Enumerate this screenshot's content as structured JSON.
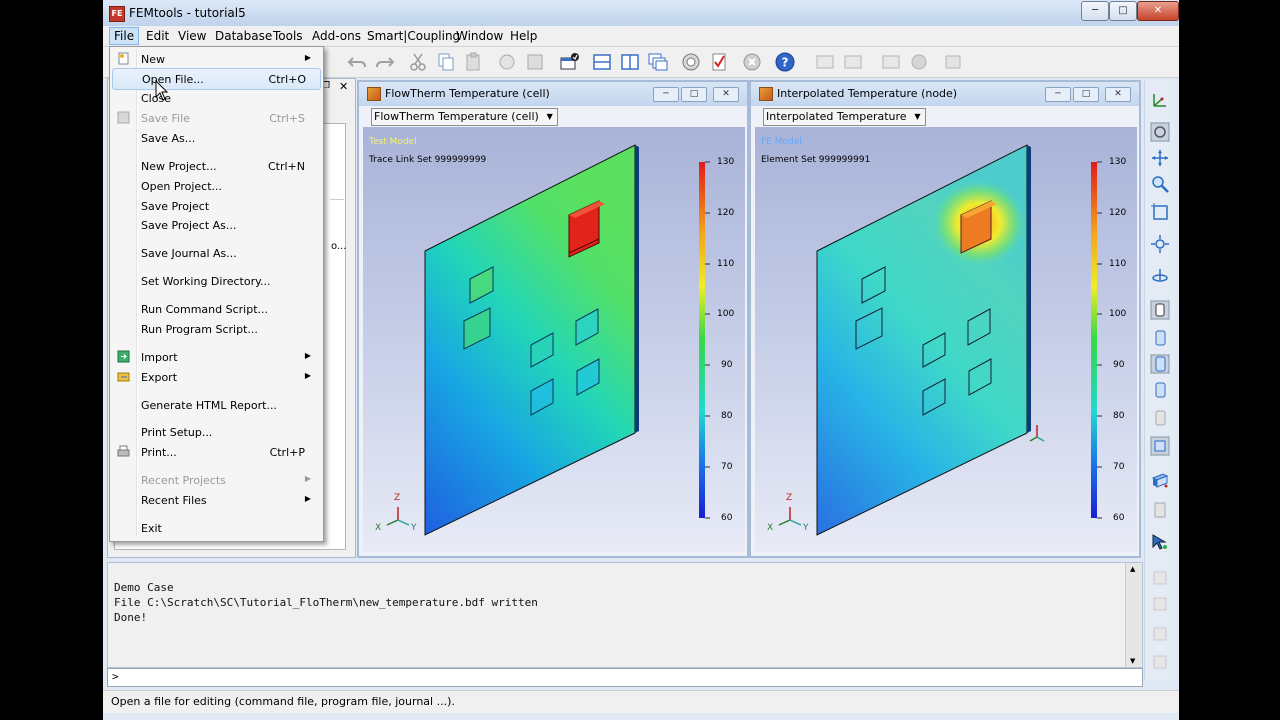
{
  "window": {
    "title": "FEMtools - tutorial5",
    "app_icon": "FE"
  },
  "menubar": [
    "File",
    "Edit",
    "View",
    "Database",
    "Tools",
    "Add-ons",
    "Smart|Coupling",
    "Window",
    "Help"
  ],
  "file_menu": [
    {
      "label": "New",
      "submenu": true
    },
    {
      "label": "Open File...",
      "shortcut": "Ctrl+O"
    },
    {
      "label": "Close"
    },
    {
      "label": "Save File",
      "shortcut": "Ctrl+S",
      "disabled": true
    },
    {
      "label": "Save As..."
    },
    {
      "label": "New Project...",
      "shortcut": "Ctrl+N"
    },
    {
      "label": "Open Project..."
    },
    {
      "label": "Save Project"
    },
    {
      "label": "Save Project As..."
    },
    {
      "label": "Save Journal As..."
    },
    {
      "label": "Set Working Directory..."
    },
    {
      "label": "Run Command Script..."
    },
    {
      "label": "Run Program Script..."
    },
    {
      "label": "Import",
      "submenu": true
    },
    {
      "label": "Export",
      "submenu": true
    },
    {
      "label": "Generate HTML Report..."
    },
    {
      "label": "Print Setup..."
    },
    {
      "label": "Print...",
      "shortcut": "Ctrl+P"
    },
    {
      "label": "Recent Projects",
      "submenu": true,
      "disabled": true
    },
    {
      "label": "Recent Files",
      "submenu": true
    },
    {
      "label": "Exit"
    }
  ],
  "viewports": [
    {
      "title": "FlowTherm Temperature (cell)",
      "select_value": "FlowTherm Temperature (cell)",
      "model_label": "Test Model",
      "set_label": "Trace Link Set 999999999",
      "legend_ticks": [
        "130",
        "120",
        "110",
        "100",
        "90",
        "80",
        "70",
        "60"
      ]
    },
    {
      "title": "Interpolated Temperature (node)",
      "select_value": "Interpolated Temperature",
      "model_label": "FE Model",
      "set_label": "Element Set 999999991",
      "legend_ticks": [
        "130",
        "120",
        "110",
        "100",
        "90",
        "80",
        "70",
        "60"
      ]
    }
  ],
  "axis_triad": {
    "x": "X",
    "y": "Y",
    "z": "Z"
  },
  "left_panel": {
    "truncated_text": "o..."
  },
  "console": {
    "lines": [
      "Demo Case",
      "File C:\\Scratch\\SC\\Tutorial_FloTherm\\new_temperature.bdf written",
      "Done!"
    ],
    "prompt": ">"
  },
  "statusbar": {
    "text": "Open a file for editing (command file, program file, journal ...)."
  },
  "colors": {
    "hot": "#e0221c",
    "cold": "#1836d6",
    "accent": "#7eb4ea"
  }
}
